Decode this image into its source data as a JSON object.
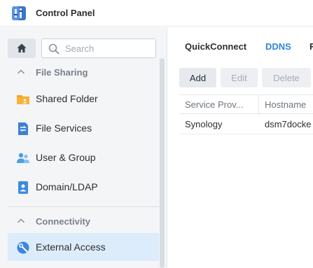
{
  "window": {
    "title": "Control Panel"
  },
  "sidebar": {
    "search_placeholder": "Search",
    "sections": [
      {
        "label": "File Sharing"
      },
      {
        "label": "Connectivity"
      }
    ],
    "items": [
      {
        "label": "Shared Folder",
        "icon": "shared-folder-icon",
        "color": "#f5a623"
      },
      {
        "label": "File Services",
        "icon": "file-services-icon",
        "color": "#3d7fd9"
      },
      {
        "label": "User & Group",
        "icon": "user-group-icon",
        "color": "#4a9fe8"
      },
      {
        "label": "Domain/LDAP",
        "icon": "domain-ldap-icon",
        "color": "#3d8ae0"
      },
      {
        "label": "External Access",
        "icon": "external-access-icon",
        "color": "#3b86e0",
        "active": true
      }
    ]
  },
  "main": {
    "tabs": [
      {
        "label": "QuickConnect"
      },
      {
        "label": "DDNS",
        "active": true
      },
      {
        "label": "R"
      }
    ],
    "toolbar": {
      "add": "Add",
      "edit": "Edit",
      "delete": "Delete"
    },
    "table": {
      "columns": [
        "Service Prov...",
        "Hostname"
      ],
      "rows": [
        [
          "Synology",
          "dsm7docke"
        ]
      ]
    }
  },
  "colors": {
    "accent": "#2f86db",
    "active_bg": "#dcecfb"
  }
}
